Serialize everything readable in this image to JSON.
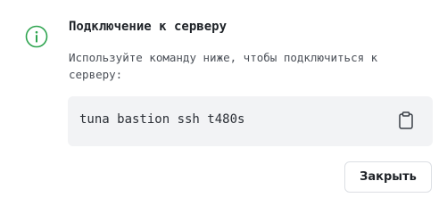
{
  "dialog": {
    "title": "Подключение к серверу",
    "description": "Используйте команду ниже, чтобы подключиться к серверу:",
    "icon": "info-circle-icon",
    "accent_color": "#2ea44f"
  },
  "command": {
    "text": "tuna bastion ssh t480s",
    "copy_icon": "clipboard-icon"
  },
  "actions": {
    "close_label": "Закрыть"
  }
}
